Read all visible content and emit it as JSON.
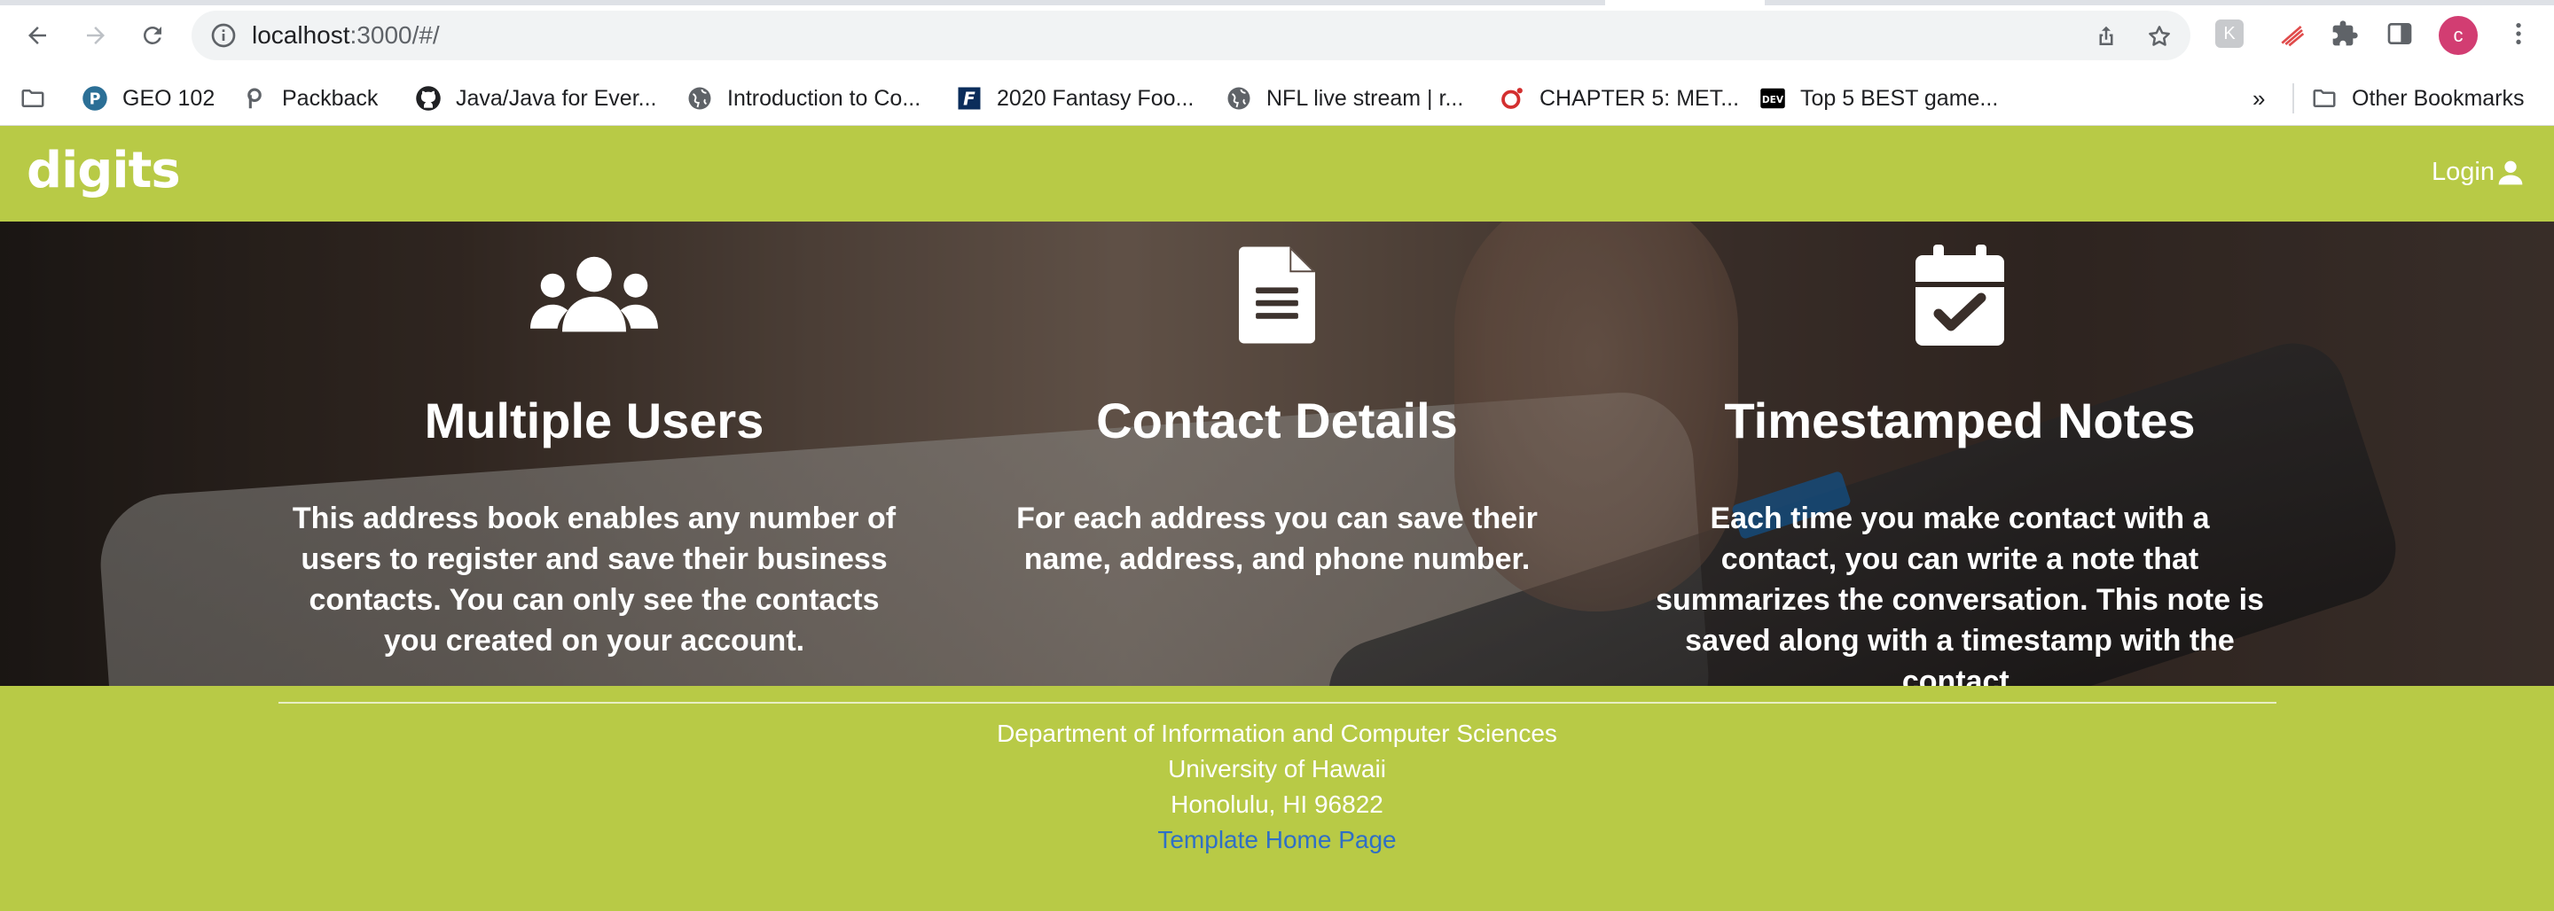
{
  "browser": {
    "url_host": "localhost",
    "url_path": ":3000/#/",
    "profile_initial": "c",
    "bookmarks": [
      {
        "label": "GEO 102",
        "icon": "pinterest-icon"
      },
      {
        "label": "Packback",
        "icon": "packback-icon"
      },
      {
        "label": "Java/Java for Ever...",
        "icon": "github-icon"
      },
      {
        "label": "Introduction to Co...",
        "icon": "globe-icon"
      },
      {
        "label": "2020 Fantasy Foo...",
        "icon": "fantasy-icon"
      },
      {
        "label": "NFL live stream | r...",
        "icon": "globe-icon"
      },
      {
        "label": "CHAPTER 5: MET...",
        "icon": "opera-icon"
      },
      {
        "label": "Top 5 BEST game...",
        "icon": "dev-icon"
      }
    ],
    "bookmarks_more": "»",
    "other_bookmarks": "Other Bookmarks"
  },
  "navbar": {
    "brand": "digits",
    "login": "Login"
  },
  "features": [
    {
      "icon": "users-icon",
      "title": "Multiple Users",
      "text": "This address book enables any number of users to register and save their business contacts. You can only see the contacts you created on your account."
    },
    {
      "icon": "file-icon",
      "title": "Contact Details",
      "text": "For each address you can save their name, address, and phone number."
    },
    {
      "icon": "calendar-check-icon",
      "title": "Timestamped Notes",
      "text": "Each time you make contact with a contact, you can write a note that summarizes the conversation. This note is saved along with a timestamp with the contact."
    }
  ],
  "footer": {
    "line1": "Department of Information and Computer Sciences",
    "line2": "University of Hawaii",
    "line3": "Honolulu, HI 96822",
    "link": "Template Home Page"
  },
  "colors": {
    "brand_green": "#b8ca46",
    "link_blue": "#2f6fc6",
    "avatar_pink": "#d23d72"
  }
}
